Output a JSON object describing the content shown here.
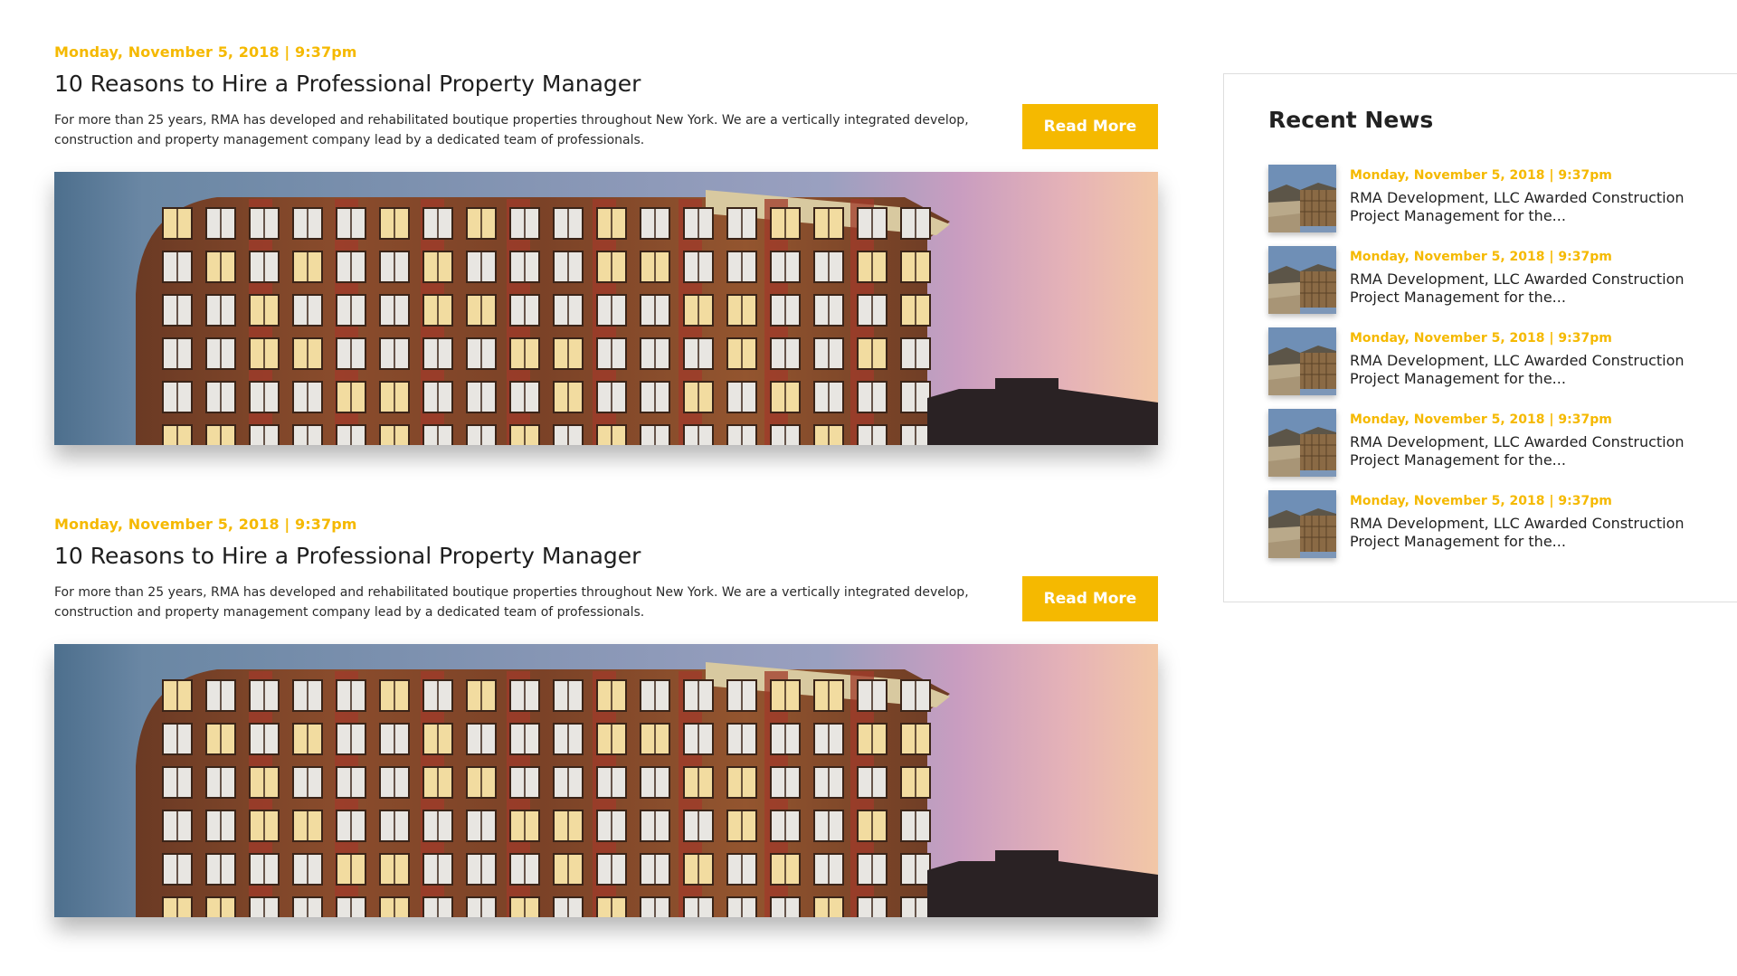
{
  "colors": {
    "accent": "#f5b900",
    "text": "#222222",
    "border": "#dedede"
  },
  "articles": [
    {
      "date": "Monday, November 5, 2018 | 9:37pm",
      "title": "10 Reasons to Hire a Professional Property Manager",
      "excerpt": "For more than 25 years, RMA has developed and rehabilitated boutique properties throughout New York. We are a vertically integrated develop, construction and property management company lead by a dedicated team of professionals.",
      "read_more_label": "Read More"
    },
    {
      "date": "Monday, November 5, 2018 | 9:37pm",
      "title": "10 Reasons to Hire a Professional Property Manager",
      "excerpt": "For more than 25 years, RMA has developed and rehabilitated boutique properties throughout New York. We are a vertically integrated develop, construction and property management company lead by a dedicated team of professionals.",
      "read_more_label": "Read More"
    }
  ],
  "sidebar": {
    "title": "Recent News",
    "items": [
      {
        "date": "Monday, November 5, 2018 | 9:37pm",
        "title": "RMA Development, LLC Awarded Construction Project Management for the..."
      },
      {
        "date": "Monday, November 5, 2018 | 9:37pm",
        "title": "RMA Development, LLC Awarded Construction Project Management for the..."
      },
      {
        "date": "Monday, November 5, 2018 | 9:37pm",
        "title": "RMA Development, LLC Awarded Construction Project Management for the..."
      },
      {
        "date": "Monday, November 5, 2018 | 9:37pm",
        "title": "RMA Development, LLC Awarded Construction Project Management for the..."
      },
      {
        "date": "Monday, November 5, 2018 | 9:37pm",
        "title": "RMA Development, LLC Awarded Construction Project Management for the..."
      }
    ]
  }
}
